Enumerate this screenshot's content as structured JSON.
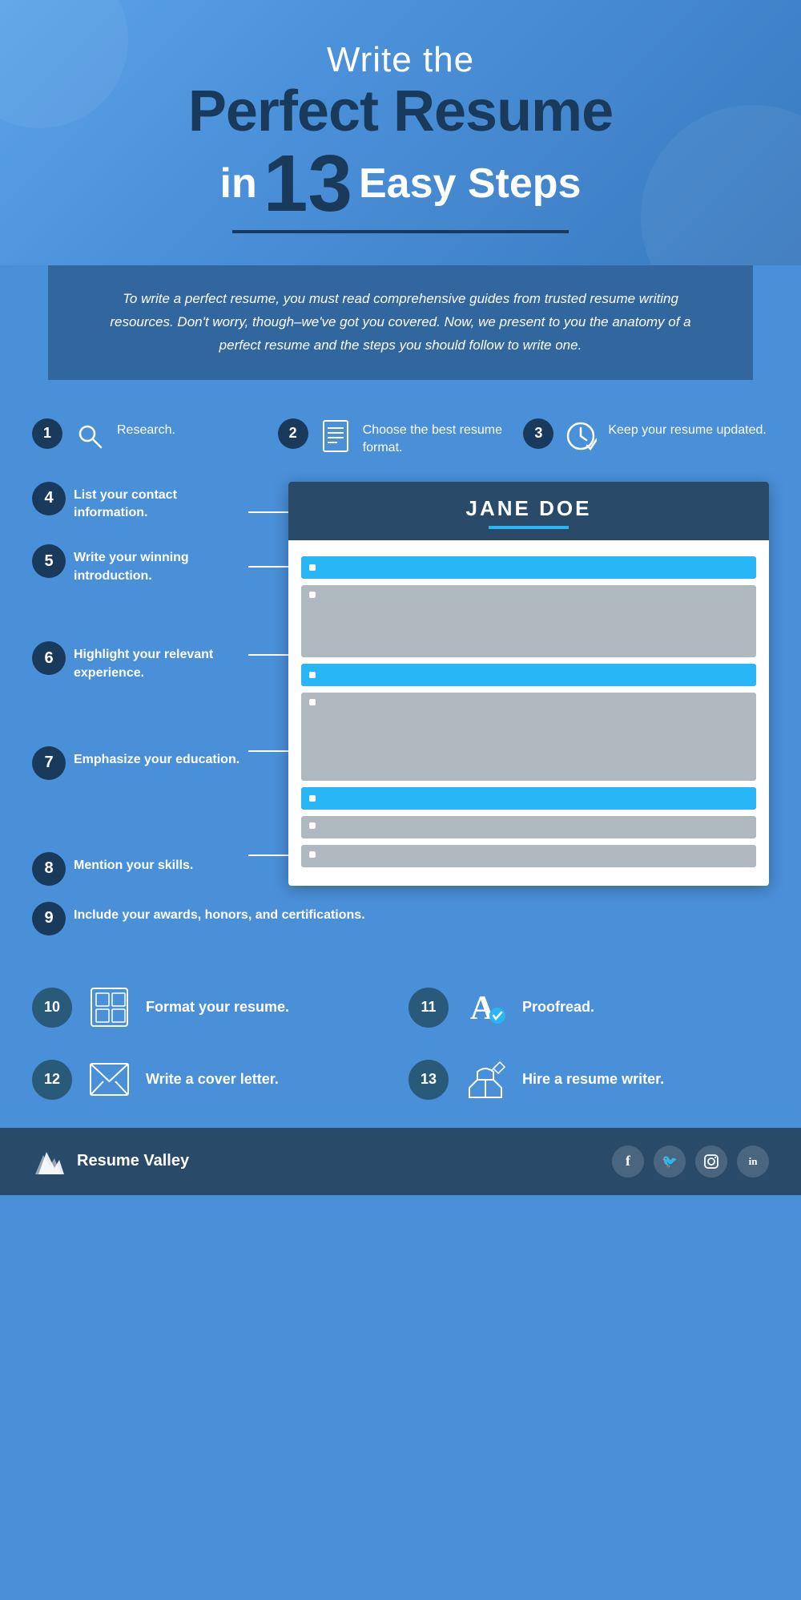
{
  "header": {
    "line1": "Write the",
    "line2": "Perfect Resume",
    "line3_pre": "in",
    "line3_num": "13",
    "line3_post": "Easy Steps"
  },
  "intro": {
    "text": "To write a perfect resume, you must read comprehensive guides from trusted resume writing resources. Don't worry, though–we've got you covered. Now, we present to you the anatomy of a perfect resume and the steps you should follow to write one."
  },
  "steps_top": [
    {
      "number": "1",
      "label": "Research.",
      "icon": "search"
    },
    {
      "number": "2",
      "label": "Choose the best resume format.",
      "icon": "document"
    },
    {
      "number": "3",
      "label": "Keep your resume updated.",
      "icon": "clock-check"
    }
  ],
  "steps_left": [
    {
      "number": "4",
      "label": "List your contact information."
    },
    {
      "number": "5",
      "label": "Write your winning introduction."
    },
    {
      "number": "6",
      "label": "Highlight your relevant experience."
    },
    {
      "number": "7",
      "label": "Emphasize your education."
    },
    {
      "number": "8",
      "label": "Mention your skills."
    }
  ],
  "step9": {
    "number": "9",
    "label": "Include your awards, honors, and certifications."
  },
  "resume": {
    "name": "JANE DOE"
  },
  "steps_bottom": [
    {
      "number": "10",
      "label": "Format your resume.",
      "icon": "format"
    },
    {
      "number": "11",
      "label": "Proofread.",
      "icon": "proofread"
    },
    {
      "number": "12",
      "label": "Write a cover letter.",
      "icon": "cover-letter"
    },
    {
      "number": "13",
      "label": "Hire a resume writer.",
      "icon": "writer"
    }
  ],
  "footer": {
    "brand": "Resume Valley",
    "social": [
      "f",
      "t",
      "📷",
      "in"
    ]
  }
}
